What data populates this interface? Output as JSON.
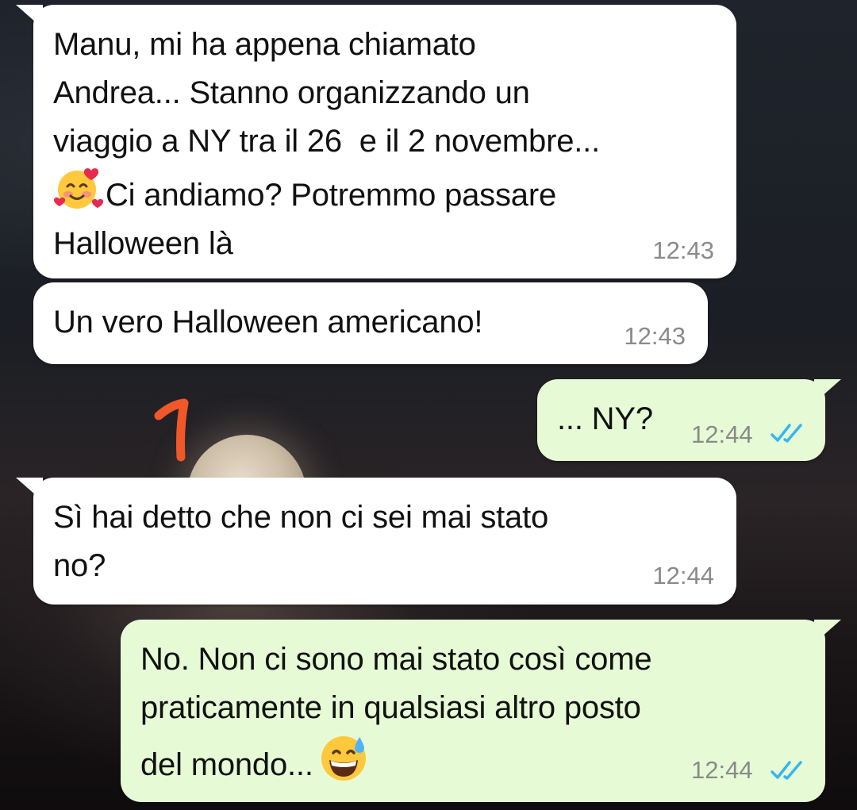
{
  "messages": [
    {
      "direction": "incoming",
      "lines": [
        "Manu, mi ha appena chiamato",
        "Andrea... Stanno organizzando un",
        "viaggio a NY tra il 26  e il 2 novembre...",
        "Ci andiamo? Potremmo passare",
        "Halloween là"
      ],
      "emoji": "smiling-face-with-hearts",
      "time": "12:43"
    },
    {
      "direction": "incoming",
      "lines": [
        "Un vero Halloween americano!"
      ],
      "time": "12:43"
    },
    {
      "direction": "outgoing",
      "lines": [
        "... NY?"
      ],
      "time": "12:44",
      "status": "read"
    },
    {
      "direction": "incoming",
      "lines": [
        "Sì hai detto che non ci sei mai stato",
        "no?"
      ],
      "time": "12:44"
    },
    {
      "direction": "outgoing",
      "lines": [
        "No. Non ci sono mai stato così come",
        "praticamente in qualsiasi altro posto",
        "del mondo..."
      ],
      "emoji": "grinning-face-with-sweat",
      "time": "12:44",
      "status": "read"
    }
  ],
  "colors": {
    "incoming_bubble": "#ffffff",
    "outgoing_bubble": "#e6fbd5",
    "read_ticks": "#34b7f1",
    "timestamp": "#8a8a8a",
    "annotation": "#f0582a"
  }
}
